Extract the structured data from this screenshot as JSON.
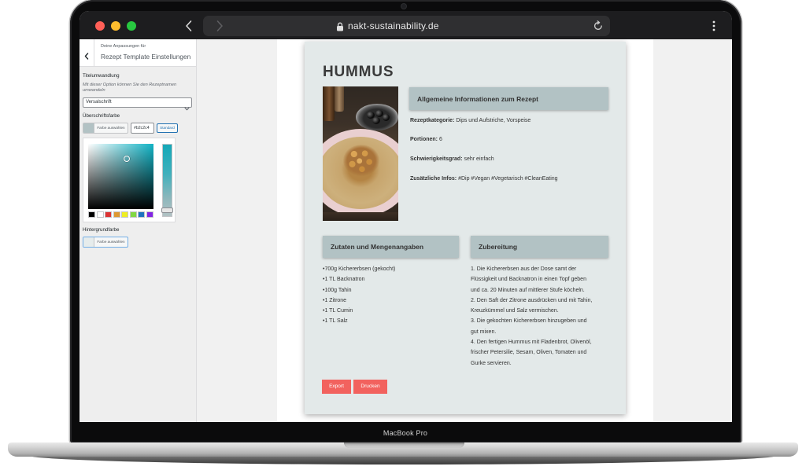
{
  "device": {
    "model_label": "MacBook Pro"
  },
  "browser": {
    "url": "nakt-sustainability.de",
    "icons": {
      "back": "chevron-left-icon",
      "forward": "chevron-right-icon",
      "lock": "lock-icon",
      "reload": "reload-icon",
      "menu": "more-vertical-icon"
    }
  },
  "customizer": {
    "header": {
      "back_icon": "chevron-left-icon",
      "subtitle": "Deine Anpassungen für",
      "title": "Rezept Template Einstellungen"
    },
    "title_transform": {
      "label": "Titelumwandlung",
      "description": "Mit dieser Option können Sie den Rezeptnamen umwandeln",
      "selected": "Versalschrift"
    },
    "heading_color": {
      "label": "Überschriftsfarbe",
      "pick_button": "Farbe auswählen",
      "value": "#b2c2c4",
      "default_button": "Standard",
      "palette": [
        "#000000",
        "#ffffff",
        "#dd3333",
        "#dd9933",
        "#eeee22",
        "#81d742",
        "#1e73be",
        "#8224e3"
      ]
    },
    "background_color": {
      "label": "Hintergrundfarbe",
      "pick_button": "Farbe auswählen"
    }
  },
  "recipe": {
    "title": "HUMMUS",
    "info": {
      "heading": "Allgemeine Informationen zum Rezept",
      "items": [
        {
          "key": "Rezeptkategorie:",
          "value": "Dips und Aufstriche, Vorspeise"
        },
        {
          "key": "Portionen:",
          "value": "6"
        },
        {
          "key": "Schwierigkeitsgrad:",
          "value": "sehr einfach"
        },
        {
          "key": "Zusätzliche Infos:",
          "value": "#Dip #Vegan #Vegetarisch #CleanEating"
        }
      ]
    },
    "ingredients": {
      "heading": "Zutaten und Mengenangaben",
      "items": [
        "700g Kichererbsen (gekocht)",
        "1 TL Backnatron",
        "100g Tahin",
        "1 Zitrone",
        "1 TL Cumin",
        "1 TL Salz"
      ]
    },
    "preparation": {
      "heading": "Zubereitung",
      "lines": [
        "1. Die Kichererbsen aus der Dose samt der",
        "Flüssigkeit und Backnatron in einen Topf geben",
        "und ca. 20 Minuten auf mittlerer Stufe köcheln.",
        "2. Den Saft der Zitrone ausdrücken und mit Tahin,",
        "Kreuzkümmel und Salz vermischen.",
        "3. Die gekochten Kichererbsen hinzugeben und",
        "gut mixen.",
        "4. Den fertigen Hummus mit Fladenbrot, Olivenöl,",
        "frischer Petersilie, Sesam, Oliven, Tomaten und",
        "Gurke servieren."
      ]
    },
    "actions": {
      "export": "Export",
      "print": "Drucken"
    }
  },
  "colors": {
    "heading_bg": "#b2c2c4",
    "card_bg": "#e3e9e9",
    "action_button": "#f2625e",
    "wp_accent": "#2271b1",
    "traffic_red": "#ff5f57",
    "traffic_yellow": "#febc2e",
    "traffic_green": "#28c840"
  }
}
